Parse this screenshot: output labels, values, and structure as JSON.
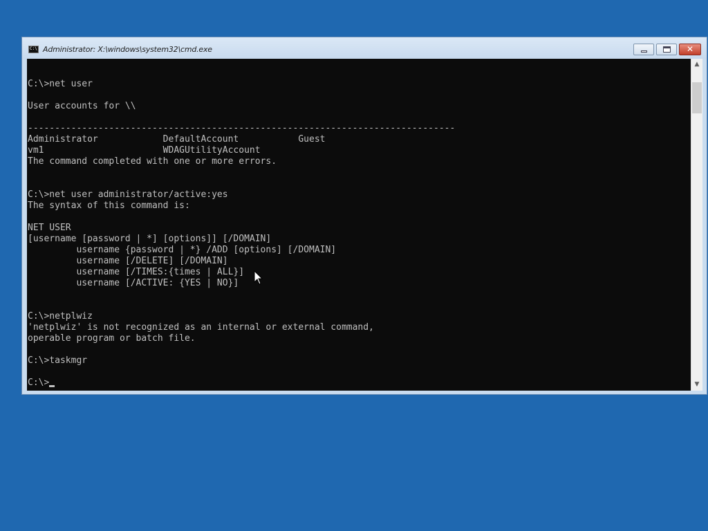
{
  "window": {
    "title": "Administrator: X:\\windows\\system32\\cmd.exe",
    "icon_label": "C:\\",
    "minimize_icon": "minimize-icon",
    "maximize_icon": "restore-icon",
    "close_icon": "close-icon",
    "close_label": "✕"
  },
  "console": {
    "text": "C:\\>net user\n\nUser accounts for \\\\\n\n-------------------------------------------------------------------------------\nAdministrator            DefaultAccount           Guest\nvm1                      WDAGUtilityAccount\nThe command completed with one or more errors.\n\n\nC:\\>net user administrator/active:yes\nThe syntax of this command is:\n\nNET USER\n[username [password | *] [options]] [/DOMAIN]\n         username {password | *} /ADD [options] [/DOMAIN]\n         username [/DELETE] [/DOMAIN]\n         username [/TIMES:{times | ALL}]\n         username [/ACTIVE: {YES | NO}]\n\n\nC:\\>netplwiz\n'netplwiz' is not recognized as an internal or external command,\noperable program or batch file.\n\nC:\\>taskmgr\n\n",
    "prompt": "C:\\>",
    "colors": {
      "background": "#0c0c0c",
      "foreground": "#c0c0c0"
    }
  },
  "scrollbar": {
    "up_arrow": "▲",
    "down_arrow": "▼"
  },
  "desktop": {
    "background_color": "#1f68b0"
  }
}
